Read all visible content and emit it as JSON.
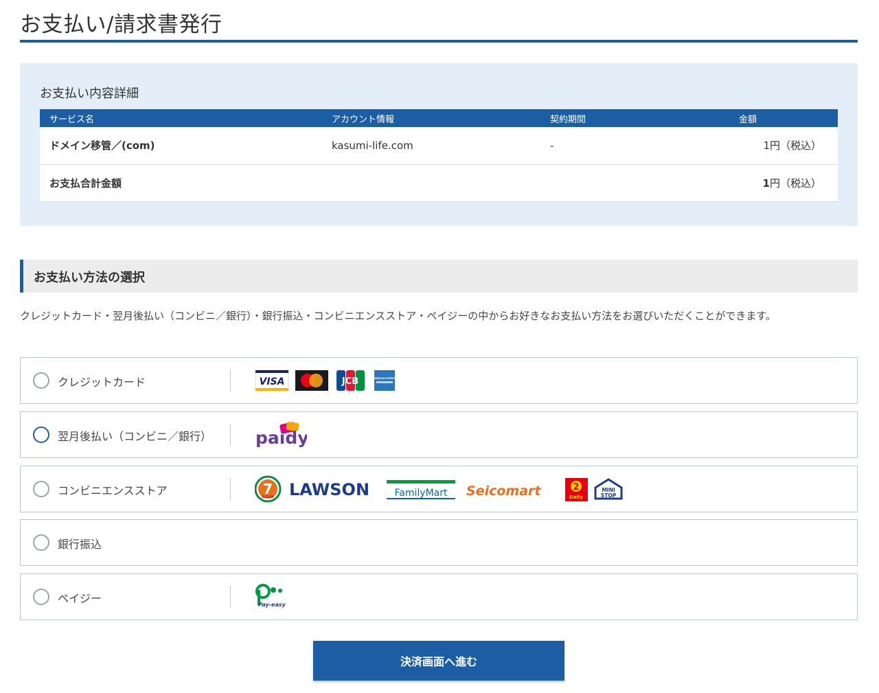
{
  "page": {
    "title": "お支払い/請求書発行"
  },
  "detail": {
    "heading": "お支払い内容詳細",
    "columns": [
      "サービス名",
      "アカウント情報",
      "契約期間",
      "金額"
    ],
    "row": {
      "service": "ドメイン移管／(com)",
      "account": "kasumi-life.com",
      "period": "-",
      "amount": "1円（税込）"
    },
    "total": {
      "label": "お支払合計金額",
      "amount_value": "1",
      "amount_unit": "円（税込）"
    }
  },
  "payment": {
    "heading": "お支払い方法の選択",
    "intro": "クレジットカード・翌月後払い（コンビニ／銀行）・銀行振込・コンビニエンスストア・ペイジーの中からお好きなお支払い方法をお選びいただくことができます。",
    "methods": [
      {
        "label": "クレジットカード",
        "selected": false
      },
      {
        "label": "翌月後払い（コンビニ／銀行）",
        "selected": false
      },
      {
        "label": "コンビニエンスストア",
        "selected": false
      },
      {
        "label": "銀行振込",
        "selected": false
      },
      {
        "label": "ペイジー",
        "selected": false
      }
    ],
    "logos": {
      "visa": "VISA",
      "jcb": "JCB",
      "amex": "AMERICAN EXPRESS",
      "paidy": "paidy",
      "seven": "7",
      "seven_sub": "ELEVEN",
      "lawson": "LAWSON",
      "familymart": "FamilyMart",
      "seicomart": "Seicomart",
      "daily_num": "2",
      "daily": "Daily",
      "ministop_1": "MINI",
      "ministop_2": "STOP",
      "payeasy": "Pay-easy"
    }
  },
  "button": {
    "label": "決済画面へ進む"
  },
  "colors": {
    "primary": "#1b5ea3",
    "panel": "#e4eef9",
    "section_bg": "#ececec"
  }
}
